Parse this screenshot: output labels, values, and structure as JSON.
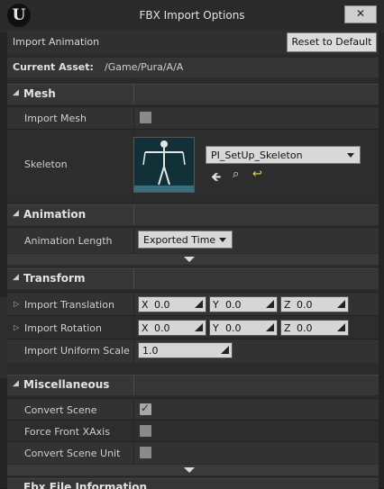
{
  "window": {
    "title": "FBX Import Options",
    "close_symbol": "✕",
    "logo_char": "U"
  },
  "toolbar": {
    "section_label": "Import Animation",
    "reset_label": "Reset to Default"
  },
  "current_asset": {
    "label": "Current Asset:",
    "value": "/Game/Pura/A/A"
  },
  "sections": {
    "mesh": {
      "title": "Mesh",
      "import_mesh_label": "Import Mesh",
      "skeleton_label": "Skeleton",
      "skeleton_value": "PI_SetUp_Skeleton"
    },
    "animation": {
      "title": "Animation",
      "length_label": "Animation Length",
      "length_value": "Exported Time"
    },
    "transform": {
      "title": "Transform",
      "translation_label": "Import Translation",
      "rotation_label": "Import Rotation",
      "scale_label": "Import Uniform Scale",
      "axis_x": "X",
      "axis_y": "Y",
      "axis_z": "Z",
      "tx": "0.0",
      "ty": "0.0",
      "tz": "0.0",
      "rx": "0.0",
      "ry": "0.0",
      "rz": "0.0",
      "scale": "1.0"
    },
    "misc": {
      "title": "Miscellaneous",
      "convert_scene_label": "Convert Scene",
      "force_front_label": "Force Front XAxis",
      "convert_unit_label": "Convert Scene Unit",
      "convert_scene_checked": true
    },
    "fbx_info": {
      "title": "Fbx File Information"
    }
  },
  "colors": {
    "window_bg": "#242424",
    "button_bg": "#dcdcdc",
    "category_bg": "#363636"
  },
  "icons": [
    "ue-logo-icon",
    "close-icon",
    "arrow-left-icon",
    "search-icon",
    "reset-arrow-icon"
  ]
}
